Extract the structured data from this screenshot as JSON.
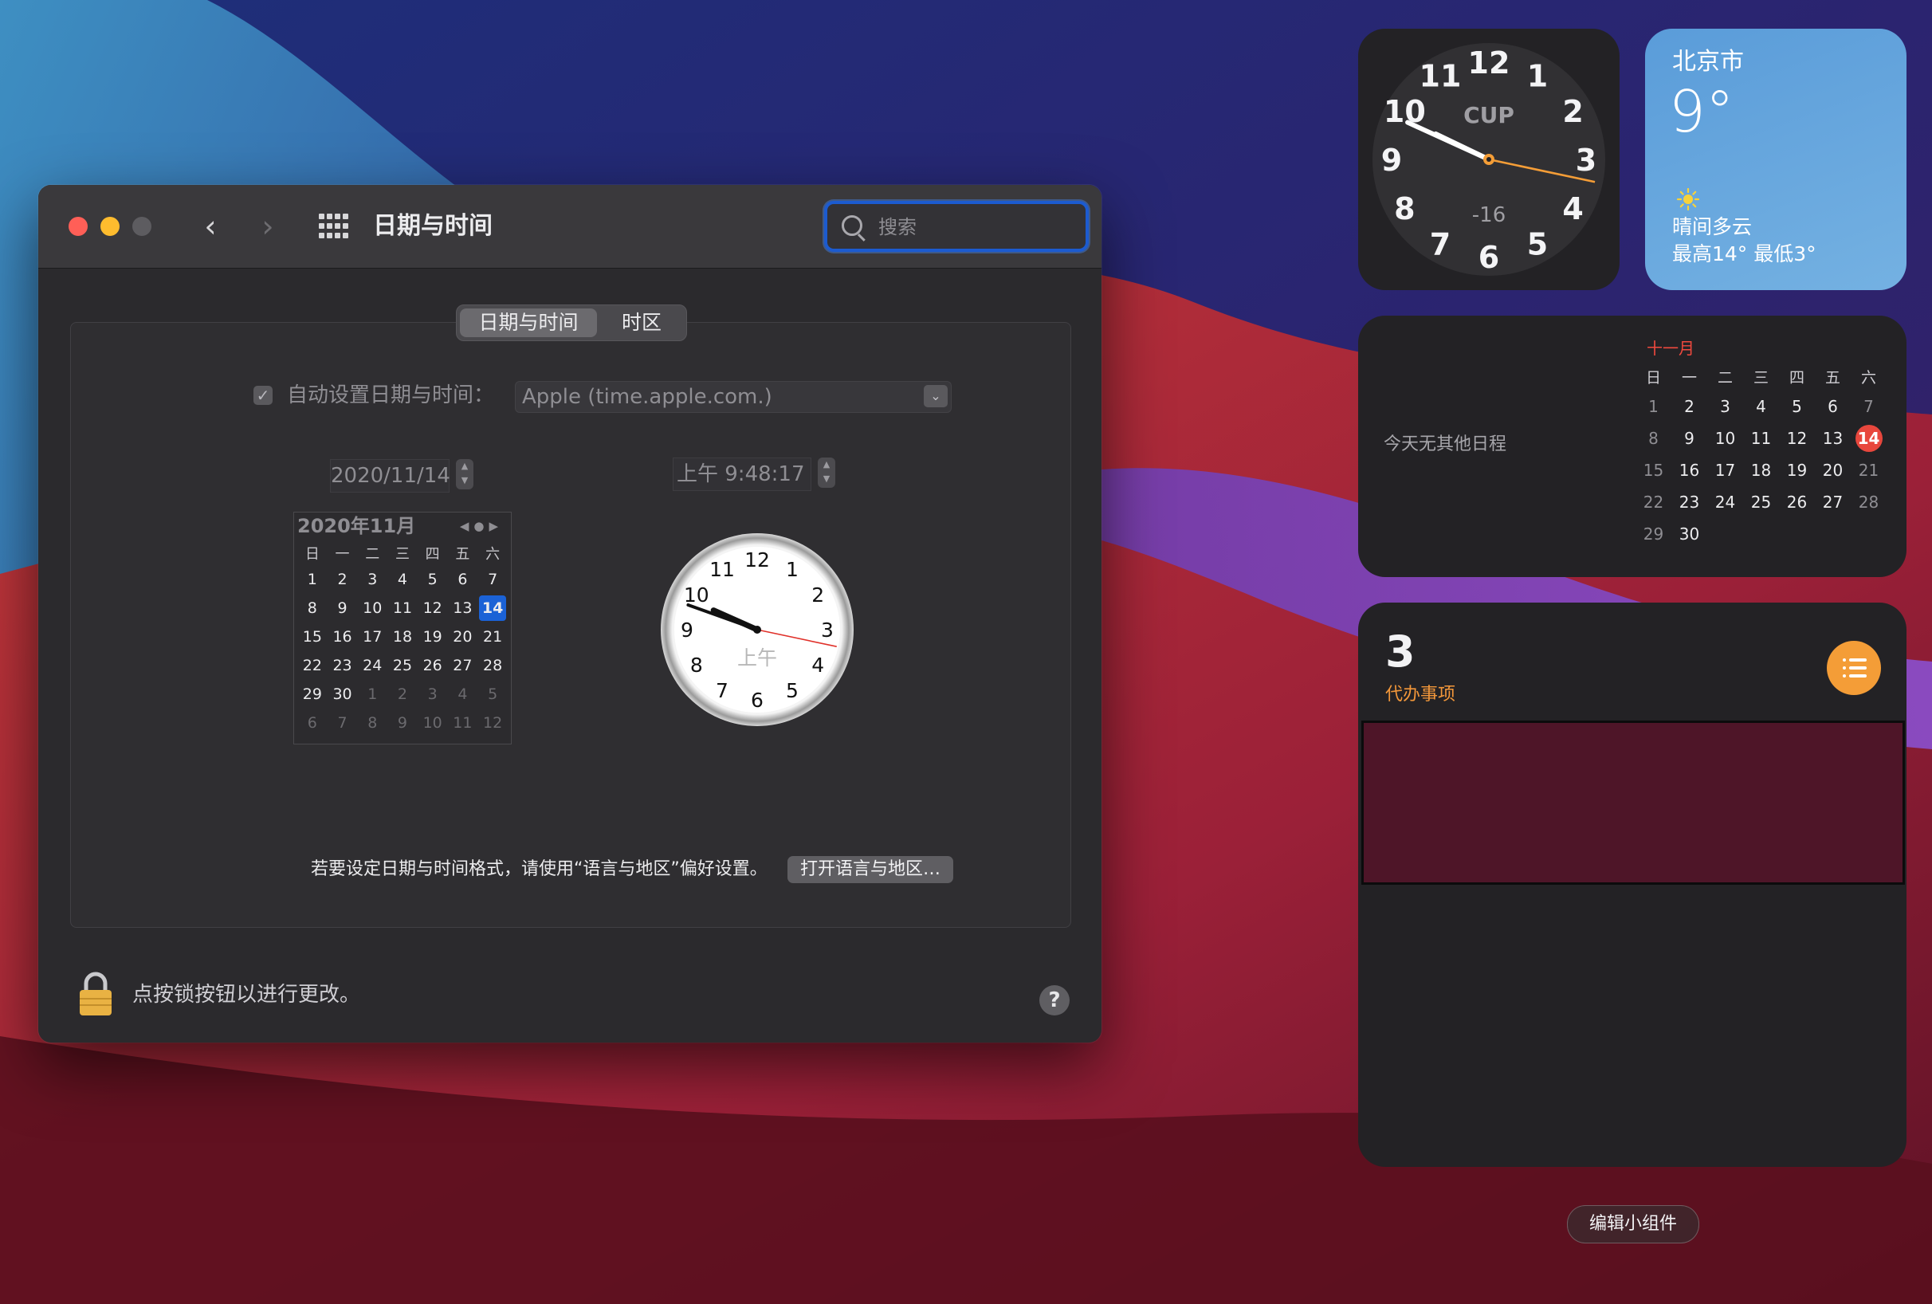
{
  "window": {
    "title": "日期与时间",
    "search_placeholder": "搜索",
    "tabs": [
      {
        "label": "日期与时间",
        "selected": true
      },
      {
        "label": "时区",
        "selected": false
      }
    ],
    "auto_set_label": "自动设置日期与时间：",
    "auto_set_checked": true,
    "time_server": "Apple (time.apple.com.)",
    "date_value": "2020/11/14",
    "time_value": "上午  9:48:17",
    "mini_calendar": {
      "header": "2020年11月",
      "weekdays": [
        "日",
        "一",
        "二",
        "三",
        "四",
        "五",
        "六"
      ],
      "selected_day": "14",
      "rows": [
        [
          {
            "d": "1"
          },
          {
            "d": "2"
          },
          {
            "d": "3"
          },
          {
            "d": "4"
          },
          {
            "d": "5"
          },
          {
            "d": "6"
          },
          {
            "d": "7"
          }
        ],
        [
          {
            "d": "8"
          },
          {
            "d": "9"
          },
          {
            "d": "10"
          },
          {
            "d": "11"
          },
          {
            "d": "12"
          },
          {
            "d": "13"
          },
          {
            "d": "14",
            "sel": true
          }
        ],
        [
          {
            "d": "15"
          },
          {
            "d": "16"
          },
          {
            "d": "17"
          },
          {
            "d": "18"
          },
          {
            "d": "19"
          },
          {
            "d": "20"
          },
          {
            "d": "21"
          }
        ],
        [
          {
            "d": "22"
          },
          {
            "d": "23"
          },
          {
            "d": "24"
          },
          {
            "d": "25"
          },
          {
            "d": "26"
          },
          {
            "d": "27"
          },
          {
            "d": "28"
          }
        ],
        [
          {
            "d": "29"
          },
          {
            "d": "30"
          },
          {
            "d": "1",
            "dim": true
          },
          {
            "d": "2",
            "dim": true
          },
          {
            "d": "3",
            "dim": true
          },
          {
            "d": "4",
            "dim": true
          },
          {
            "d": "5",
            "dim": true
          }
        ],
        [
          {
            "d": "6",
            "dim": true
          },
          {
            "d": "7",
            "dim": true
          },
          {
            "d": "8",
            "dim": true
          },
          {
            "d": "9",
            "dim": true
          },
          {
            "d": "10",
            "dim": true
          },
          {
            "d": "11",
            "dim": true
          },
          {
            "d": "12",
            "dim": true
          }
        ]
      ]
    },
    "analog_clock": {
      "am_pm": "上午",
      "time": {
        "h": 9,
        "m": 48,
        "s": 17
      },
      "numbers": [
        "12",
        "1",
        "2",
        "3",
        "4",
        "5",
        "6",
        "7",
        "8",
        "9",
        "10",
        "11"
      ]
    },
    "format_text": "若要设定日期与时间格式，请使用“语言与地区”偏好设置。",
    "format_button": "打开语言与地区…",
    "lock_text": "点按锁按钮以进行更改。",
    "help_label": "?"
  },
  "widgets": {
    "clock": {
      "city": "CUP",
      "offset": "-16",
      "time": {
        "h": 9,
        "m": 49,
        "s": 17
      },
      "numbers": [
        "12",
        "1",
        "2",
        "3",
        "4",
        "5",
        "6",
        "7",
        "8",
        "9",
        "10",
        "11"
      ]
    },
    "weather": {
      "city": "北京市",
      "temperature": "9°",
      "condition": "晴间多云",
      "high_low": "最高14° 最低3°"
    },
    "calendar": {
      "no_events": "今天无其他日程",
      "month": "十一月",
      "weekdays": [
        "日",
        "一",
        "二",
        "三",
        "四",
        "五",
        "六"
      ],
      "today": "14",
      "rows": [
        [
          "1",
          "2",
          "3",
          "4",
          "5",
          "6",
          "7"
        ],
        [
          "8",
          "9",
          "10",
          "11",
          "12",
          "13",
          "14"
        ],
        [
          "15",
          "16",
          "17",
          "18",
          "19",
          "20",
          "21"
        ],
        [
          "22",
          "23",
          "24",
          "25",
          "26",
          "27",
          "28"
        ],
        [
          "29",
          "30",
          "",
          "",
          "",
          "",
          ""
        ]
      ]
    },
    "reminders": {
      "count": "3",
      "label": "代办事项"
    },
    "edit_button": "编辑小组件"
  },
  "colors": {
    "accent_blue": "#1b62d6",
    "today_red": "#e8473d",
    "reminders_orange": "#f49d37",
    "second_hand": "#f49d37",
    "window_clock_second_hand": "#e0312a"
  }
}
